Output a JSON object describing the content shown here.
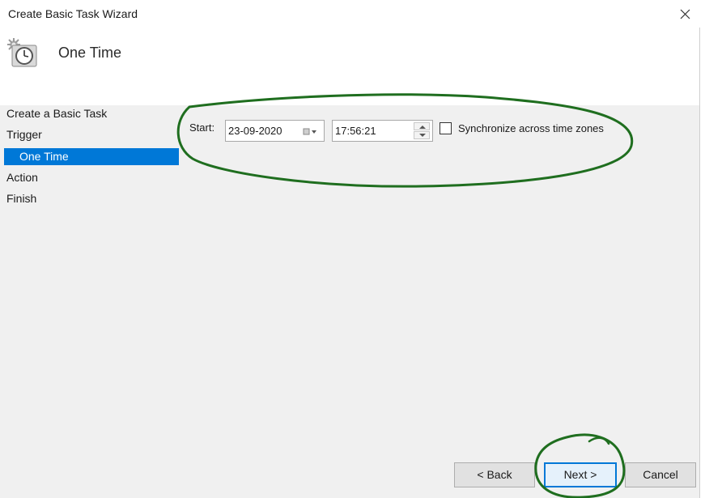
{
  "window": {
    "title": "Create Basic Task Wizard",
    "close_icon": "close-icon"
  },
  "header": {
    "title": "One Time",
    "icon": "clock-task-icon"
  },
  "steps": {
    "create": "Create a Basic Task",
    "trigger": "Trigger",
    "one_time": "One Time",
    "action": "Action",
    "finish": "Finish",
    "selected": "One Time",
    "selected_color": "#0078d7"
  },
  "start": {
    "label": "Start:",
    "date": "23-09-2020",
    "time": "17:56:21",
    "sync_label": "Synchronize across time zones",
    "sync_checked": false
  },
  "buttons": {
    "back": "< Back",
    "next": "Next >",
    "cancel": "Cancel"
  },
  "colors": {
    "accent": "#0078d7",
    "annotation": "#1f6e1f"
  }
}
